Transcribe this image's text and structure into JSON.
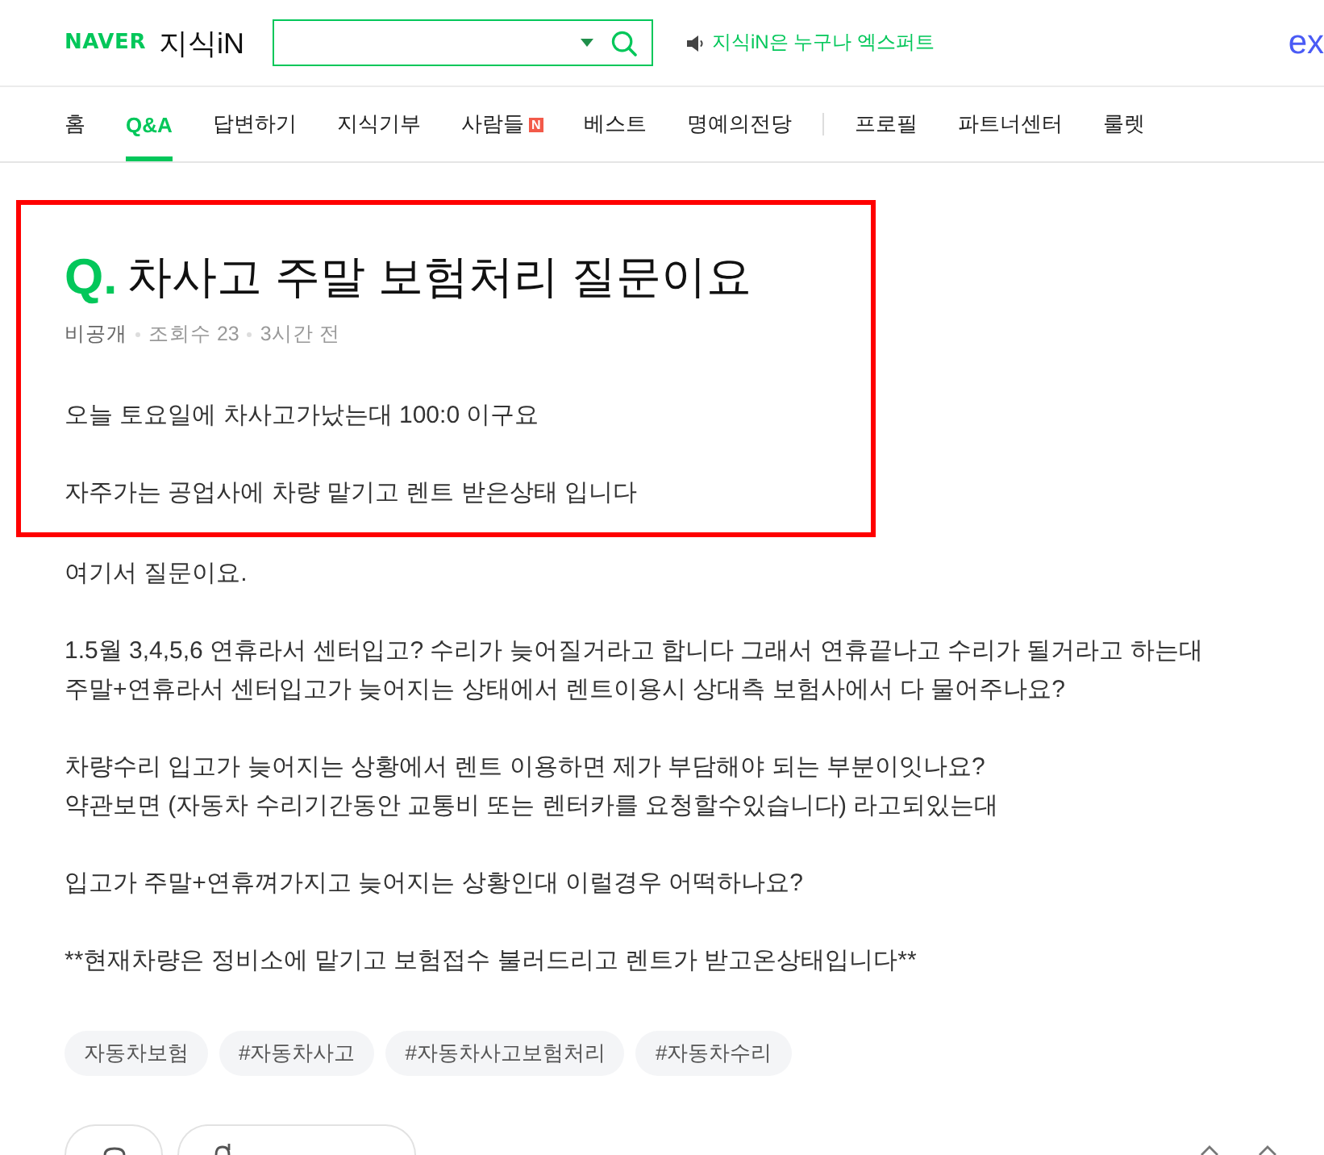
{
  "header": {
    "logo": "NAVER",
    "service": "지식iN",
    "notice": "지식iN은 누구나 엑스퍼트",
    "corner_logo": "ex"
  },
  "nav": {
    "primary": [
      {
        "label": "홈",
        "selected": false
      },
      {
        "label": "Q&A",
        "selected": true
      },
      {
        "label": "답변하기",
        "selected": false
      },
      {
        "label": "지식기부",
        "selected": false
      },
      {
        "label": "사람들",
        "selected": false,
        "badge": "N"
      },
      {
        "label": "베스트",
        "selected": false
      },
      {
        "label": "명예의전당",
        "selected": false
      }
    ],
    "secondary": [
      {
        "label": "프로필",
        "selected": false
      },
      {
        "label": "파트너센터",
        "selected": false
      },
      {
        "label": "룰렛",
        "selected": false
      }
    ]
  },
  "question": {
    "marked": true,
    "prefix": "Q.",
    "title": "차사고 주말 보험처리 질문이요",
    "meta": [
      {
        "kind": "author",
        "text": "비공개"
      },
      {
        "kind": "stat",
        "text": "조회수 23"
      },
      {
        "kind": "stat",
        "text": "3시간 전"
      }
    ],
    "paragraphs": [
      {
        "text": "오늘 토요일에 차사고가났는대 100:0 이구요",
        "marked": true
      },
      {
        "text": "자주가는 공업사에 차량 맡기고 렌트 받은상태 입니다",
        "marked": true
      },
      {
        "text": "여기서 질문이요.",
        "marked": false
      },
      {
        "text": "1.5월 3,4,5,6 연휴라서 센터입고? 수리가 늦어질거라고 합니다 그래서 연휴끝나고 수리가 될거라고 하는대\n주말+연휴라서 센터입고가 늦어지는 상태에서 렌트이용시 상대측 보험사에서 다 물어주나요?",
        "marked": false
      },
      {
        "text": "차량수리 입고가 늦어지는 상황에서 렌트 이용하면 제가 부담해야 되는 부분이잇나요?\n약관보면 (자동차 수리기간동안 교통비 또는 렌터카를 요청할수있습니다) 라고되있는대",
        "marked": false
      },
      {
        "text": "입고가 주말+연휴껴가지고 늦어지는 상황인대 이럴경우 어떡하나요?",
        "marked": false
      },
      {
        "text": "**현재차량은 정비소에 맡기고 보험접수 불러드리고 렌트가 받고온상태입니다**",
        "marked": false
      }
    ],
    "tags": [
      "자동차보험",
      "#자동차사고",
      "#자동차사고보험처리",
      "#자동차수리"
    ],
    "actions": [
      {
        "kind": "comment"
      },
      {
        "kind": "curious"
      }
    ]
  }
}
